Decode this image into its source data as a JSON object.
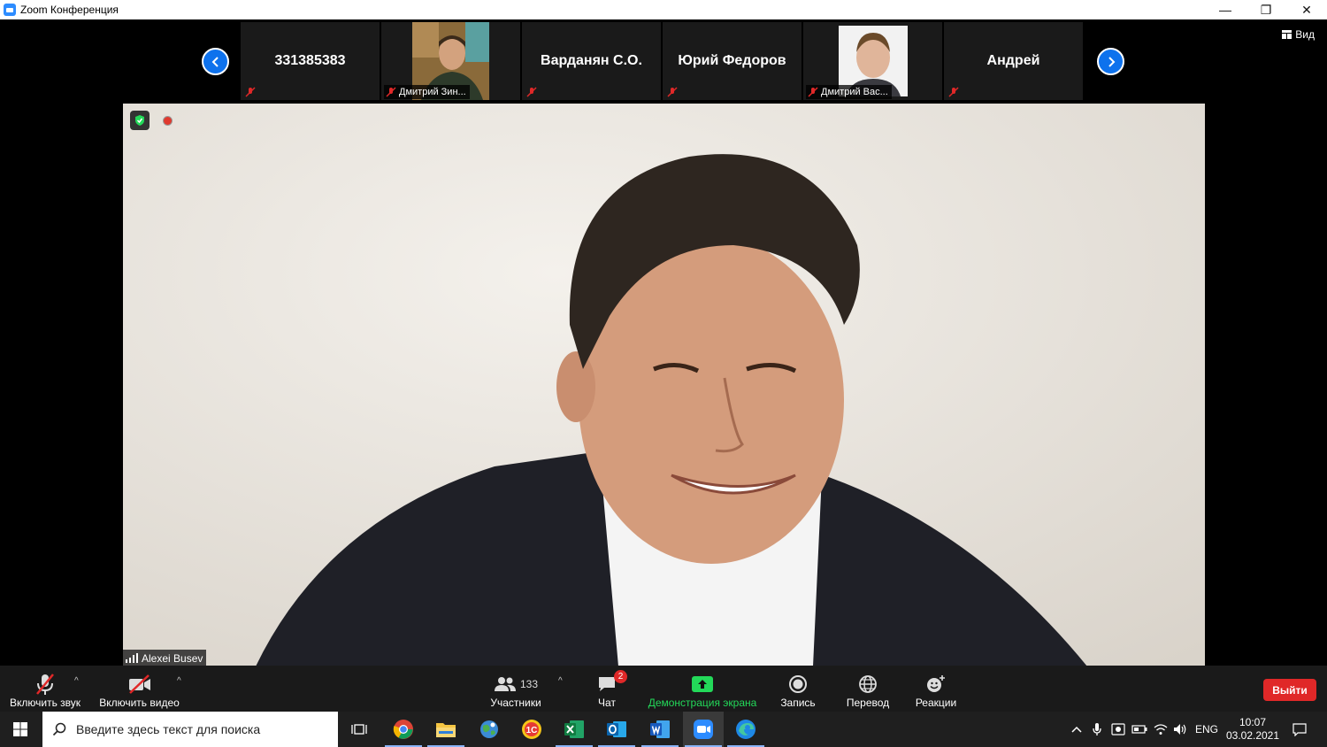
{
  "window": {
    "title": "Zoom Конференция",
    "minimize": "—",
    "restore": "❐",
    "close": "✕"
  },
  "view_button": {
    "label": "Вид"
  },
  "participants_strip": [
    {
      "name": "331385383",
      "type": "name"
    },
    {
      "name": "Дмитрий Зин...",
      "type": "photo"
    },
    {
      "name": "Варданян С.О.",
      "type": "name"
    },
    {
      "name": "Юрий Федоров",
      "type": "name"
    },
    {
      "name": "Дмитрий Вас...",
      "type": "photo"
    },
    {
      "name": "Андрей",
      "type": "name"
    }
  ],
  "main_video": {
    "speaker_name": "Alexei Busev"
  },
  "toolbar": {
    "audio_label": "Включить звук",
    "video_label": "Включить видео",
    "participants_label": "Участники",
    "participants_count": "133",
    "chat_label": "Чат",
    "chat_badge": "2",
    "share_label": "Демонстрация экрана",
    "record_label": "Запись",
    "translate_label": "Перевод",
    "reactions_label": "Реакции",
    "leave_label": "Выйти",
    "caret": "^"
  },
  "taskbar": {
    "search_placeholder": "Введите здесь текст для поиска",
    "lang": "ENG",
    "time": "10:07",
    "date": "03.02.2021"
  },
  "colors": {
    "accent": "#0e72ed",
    "share_green": "#23d959",
    "leave_red": "#e02828",
    "muted_red": "#e02828"
  }
}
